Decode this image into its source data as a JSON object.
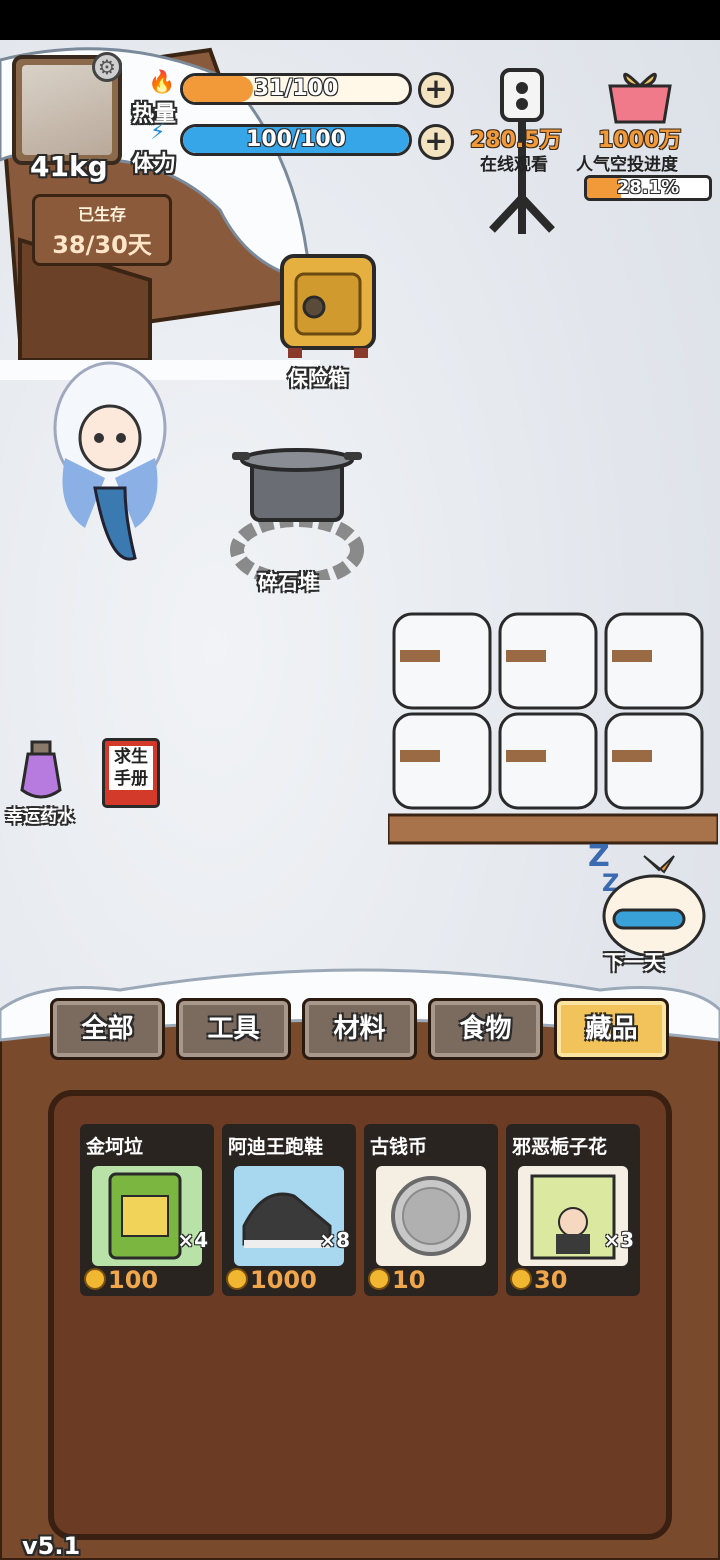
{
  "hud": {
    "weight": "41kg",
    "survive_title": "已生存",
    "survive_value": "38/30天",
    "heat_label": "热量",
    "heat_value": "31/100",
    "heat_fraction": 0.31,
    "stamina_label": "体力",
    "stamina_value": "100/100",
    "stamina_fraction": 1.0,
    "heat_color": "#f29a3a",
    "stamina_color": "#37a6e8"
  },
  "stream": {
    "viewers": "280.5万",
    "fire_count": "1000万",
    "viewers_label": "在线观看",
    "airdrop_label": "人气空投进度",
    "airdrop_progress_text": "28.1%",
    "airdrop_progress": 0.281
  },
  "scene": {
    "safe_label": "保险箱",
    "stones_label": "碎石堆",
    "potion_label": "幸运药水",
    "manual_label": "求生手册",
    "next_day_label": "下一天"
  },
  "tabs": [
    {
      "label": "全部",
      "active": false
    },
    {
      "label": "工具",
      "active": false
    },
    {
      "label": "材料",
      "active": false
    },
    {
      "label": "食物",
      "active": false
    },
    {
      "label": "藏品",
      "active": true
    }
  ],
  "items": [
    {
      "name": "金坷垃",
      "qty": "×4",
      "price": "100",
      "icon": "fertilizer-bag-icon"
    },
    {
      "name": "阿迪王跑鞋",
      "qty": "×8",
      "price": "1000",
      "icon": "sneaker-icon"
    },
    {
      "name": "古钱币",
      "qty": "",
      "price": "10",
      "icon": "coin-icon"
    },
    {
      "name": "邪恶栀子花",
      "qty": "×3",
      "price": "30",
      "icon": "book-icon"
    }
  ],
  "version": "v5.1"
}
